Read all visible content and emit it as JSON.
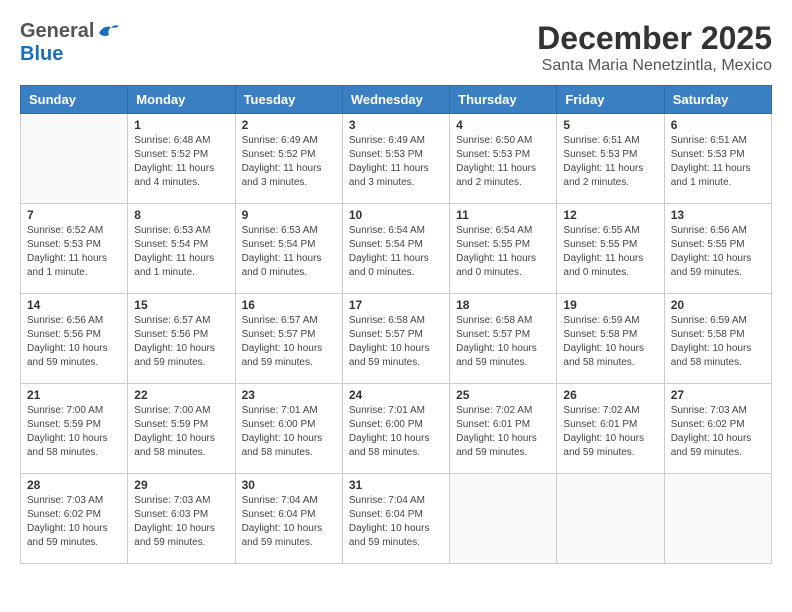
{
  "header": {
    "logo_general": "General",
    "logo_blue": "Blue",
    "month": "December 2025",
    "location": "Santa Maria Nenetzintla, Mexico"
  },
  "weekdays": [
    "Sunday",
    "Monday",
    "Tuesday",
    "Wednesday",
    "Thursday",
    "Friday",
    "Saturday"
  ],
  "weeks": [
    [
      {
        "day": "",
        "info": ""
      },
      {
        "day": "1",
        "info": "Sunrise: 6:48 AM\nSunset: 5:52 PM\nDaylight: 11 hours\nand 4 minutes."
      },
      {
        "day": "2",
        "info": "Sunrise: 6:49 AM\nSunset: 5:52 PM\nDaylight: 11 hours\nand 3 minutes."
      },
      {
        "day": "3",
        "info": "Sunrise: 6:49 AM\nSunset: 5:53 PM\nDaylight: 11 hours\nand 3 minutes."
      },
      {
        "day": "4",
        "info": "Sunrise: 6:50 AM\nSunset: 5:53 PM\nDaylight: 11 hours\nand 2 minutes."
      },
      {
        "day": "5",
        "info": "Sunrise: 6:51 AM\nSunset: 5:53 PM\nDaylight: 11 hours\nand 2 minutes."
      },
      {
        "day": "6",
        "info": "Sunrise: 6:51 AM\nSunset: 5:53 PM\nDaylight: 11 hours\nand 1 minute."
      }
    ],
    [
      {
        "day": "7",
        "info": "Sunrise: 6:52 AM\nSunset: 5:53 PM\nDaylight: 11 hours\nand 1 minute."
      },
      {
        "day": "8",
        "info": "Sunrise: 6:53 AM\nSunset: 5:54 PM\nDaylight: 11 hours\nand 1 minute."
      },
      {
        "day": "9",
        "info": "Sunrise: 6:53 AM\nSunset: 5:54 PM\nDaylight: 11 hours\nand 0 minutes."
      },
      {
        "day": "10",
        "info": "Sunrise: 6:54 AM\nSunset: 5:54 PM\nDaylight: 11 hours\nand 0 minutes."
      },
      {
        "day": "11",
        "info": "Sunrise: 6:54 AM\nSunset: 5:55 PM\nDaylight: 11 hours\nand 0 minutes."
      },
      {
        "day": "12",
        "info": "Sunrise: 6:55 AM\nSunset: 5:55 PM\nDaylight: 11 hours\nand 0 minutes."
      },
      {
        "day": "13",
        "info": "Sunrise: 6:56 AM\nSunset: 5:55 PM\nDaylight: 10 hours\nand 59 minutes."
      }
    ],
    [
      {
        "day": "14",
        "info": "Sunrise: 6:56 AM\nSunset: 5:56 PM\nDaylight: 10 hours\nand 59 minutes."
      },
      {
        "day": "15",
        "info": "Sunrise: 6:57 AM\nSunset: 5:56 PM\nDaylight: 10 hours\nand 59 minutes."
      },
      {
        "day": "16",
        "info": "Sunrise: 6:57 AM\nSunset: 5:57 PM\nDaylight: 10 hours\nand 59 minutes."
      },
      {
        "day": "17",
        "info": "Sunrise: 6:58 AM\nSunset: 5:57 PM\nDaylight: 10 hours\nand 59 minutes."
      },
      {
        "day": "18",
        "info": "Sunrise: 6:58 AM\nSunset: 5:57 PM\nDaylight: 10 hours\nand 59 minutes."
      },
      {
        "day": "19",
        "info": "Sunrise: 6:59 AM\nSunset: 5:58 PM\nDaylight: 10 hours\nand 58 minutes."
      },
      {
        "day": "20",
        "info": "Sunrise: 6:59 AM\nSunset: 5:58 PM\nDaylight: 10 hours\nand 58 minutes."
      }
    ],
    [
      {
        "day": "21",
        "info": "Sunrise: 7:00 AM\nSunset: 5:59 PM\nDaylight: 10 hours\nand 58 minutes."
      },
      {
        "day": "22",
        "info": "Sunrise: 7:00 AM\nSunset: 5:59 PM\nDaylight: 10 hours\nand 58 minutes."
      },
      {
        "day": "23",
        "info": "Sunrise: 7:01 AM\nSunset: 6:00 PM\nDaylight: 10 hours\nand 58 minutes."
      },
      {
        "day": "24",
        "info": "Sunrise: 7:01 AM\nSunset: 6:00 PM\nDaylight: 10 hours\nand 58 minutes."
      },
      {
        "day": "25",
        "info": "Sunrise: 7:02 AM\nSunset: 6:01 PM\nDaylight: 10 hours\nand 59 minutes."
      },
      {
        "day": "26",
        "info": "Sunrise: 7:02 AM\nSunset: 6:01 PM\nDaylight: 10 hours\nand 59 minutes."
      },
      {
        "day": "27",
        "info": "Sunrise: 7:03 AM\nSunset: 6:02 PM\nDaylight: 10 hours\nand 59 minutes."
      }
    ],
    [
      {
        "day": "28",
        "info": "Sunrise: 7:03 AM\nSunset: 6:02 PM\nDaylight: 10 hours\nand 59 minutes."
      },
      {
        "day": "29",
        "info": "Sunrise: 7:03 AM\nSunset: 6:03 PM\nDaylight: 10 hours\nand 59 minutes."
      },
      {
        "day": "30",
        "info": "Sunrise: 7:04 AM\nSunset: 6:04 PM\nDaylight: 10 hours\nand 59 minutes."
      },
      {
        "day": "31",
        "info": "Sunrise: 7:04 AM\nSunset: 6:04 PM\nDaylight: 10 hours\nand 59 minutes."
      },
      {
        "day": "",
        "info": ""
      },
      {
        "day": "",
        "info": ""
      },
      {
        "day": "",
        "info": ""
      }
    ]
  ]
}
